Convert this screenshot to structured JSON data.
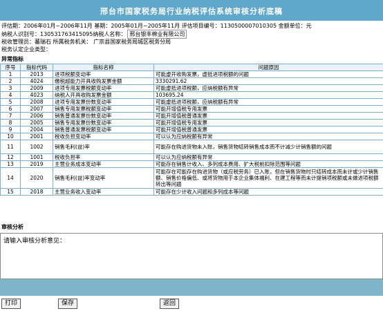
{
  "header": {
    "title": "邢台市国家税务局行业纳税评估系统审核分析底稿"
  },
  "info": {
    "line1": "评估期：2006年01月~2006年11月  基期：2005年01月~2005年11月  评估项目编号：1130500007010305  金额单位：元",
    "line2_label": "纳税人识别号：",
    "line2_id": "130531763415095",
    "line2_name_label": "  纳税人名称：",
    "line2_name": "邢台银丰棉业有限公司",
    "line3": "税收管理员：蕃瑞石  所属税务机关：  广宗县国家税务局城区税务分局",
    "line4": "税务认定企业类型："
  },
  "sections": {
    "abnormal": "异常指标",
    "analysis": "审核分析"
  },
  "table": {
    "headers": [
      "序号",
      "指标代码",
      "指标名称",
      "问题原因"
    ],
    "rows": [
      [
        "1",
        "2013",
        "进项税额变动率",
        "可能虚开收购发票，虚抵进项税额的问题"
      ],
      [
        "2",
        "4024",
        "缴税超能力开具收购发票金额",
        "3330291.62"
      ],
      [
        "3",
        "2009",
        "进项专用发票税额变动率",
        "可能虚抵进项税额，应纳税额有异常"
      ],
      [
        "4",
        "4023",
        "纳税人开具收购发票金额",
        "103695.24"
      ],
      [
        "5",
        "2008",
        "进项专用发票份数变动率",
        "可能虚抵进项税额，应纳税额有异常"
      ],
      [
        "6",
        "2007",
        "销售专用发票税额变动率",
        "可能开增值税专用发票"
      ],
      [
        "7",
        "2006",
        "销售普通发票份数变动率",
        "可能开增值税普通发票"
      ],
      [
        "8",
        "2005",
        "销售专用发票份数变动率",
        "可能开增值税专用发票"
      ],
      [
        "9",
        "2004",
        "销售普通发票税额变动率",
        "可能开增值税普通发票"
      ],
      [
        "10",
        "2001",
        "税收负担变动率",
        "可以认为应纳税额有异常"
      ],
      [
        "11",
        "1002",
        "销售毛利(益)率",
        "可能存在购进货物未入账，销售货物结转销售成本而不计减少计销售额的问题"
      ],
      [
        "12",
        "1001",
        "税收负担率",
        "可以认为应纳税额有异常"
      ],
      [
        "13",
        "2019",
        "主营业务成本变动率",
        "可能存在销售计收入、多列成本费用、扩大税前扣除范围等问题"
      ],
      [
        "14",
        "2020",
        "销售毛利(益)率变动率",
        "可能存在可能存在购进货物（或应税劳务）已入账，但在销售货物时只结转成本而未计或少计销售额、销售价格偏低、或将货物用于本企业集体福利、在建工程等而未计提销项税额或未做进项税额转出等问题"
      ],
      [
        "15",
        "2018",
        "主营业务收入变动率",
        "可能存在少计收入问题和多列成本等问题"
      ]
    ]
  },
  "analysis": {
    "placeholder": "请输入审核分析意见："
  },
  "buttons": {
    "print": "打印",
    "save": "保存",
    "back": "返回"
  }
}
